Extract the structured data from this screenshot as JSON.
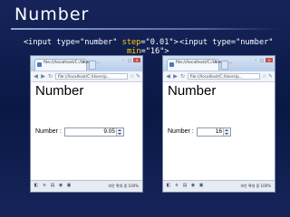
{
  "slide": {
    "title": "Number",
    "code_left_line1_pre": "<input type=\"number\" ",
    "code_left_line1_attr": "step",
    "code_left_line1_post": "=\"0.01\">",
    "code_left_line2_attr": "min",
    "code_left_line2_post": "=\"16\">",
    "code_right_line1": "<input type=\"number\""
  },
  "browsers": [
    {
      "tab_title": "file:///localhost/C:/Users/p...",
      "address": "file:///localhost/C:/Users/p...",
      "page_heading": "Number",
      "field_label": "Number :",
      "field_value": "9.05",
      "status_text": "보안 확대 중 100%"
    },
    {
      "tab_title": "file:///localhost/C:/Users/p...",
      "address": "file:///localhost/C:/Users/p...",
      "page_heading": "Number",
      "field_label": "Number :",
      "field_value": "16",
      "status_text": "보안 확대 중 100%"
    }
  ],
  "icons": {
    "tab_favicon": "page-icon",
    "tab_close": "close-icon",
    "back": "back-arrow-icon",
    "forward": "forward-arrow-icon",
    "reload": "reload-icon",
    "star": "star-icon",
    "wrench": "wrench-icon"
  }
}
